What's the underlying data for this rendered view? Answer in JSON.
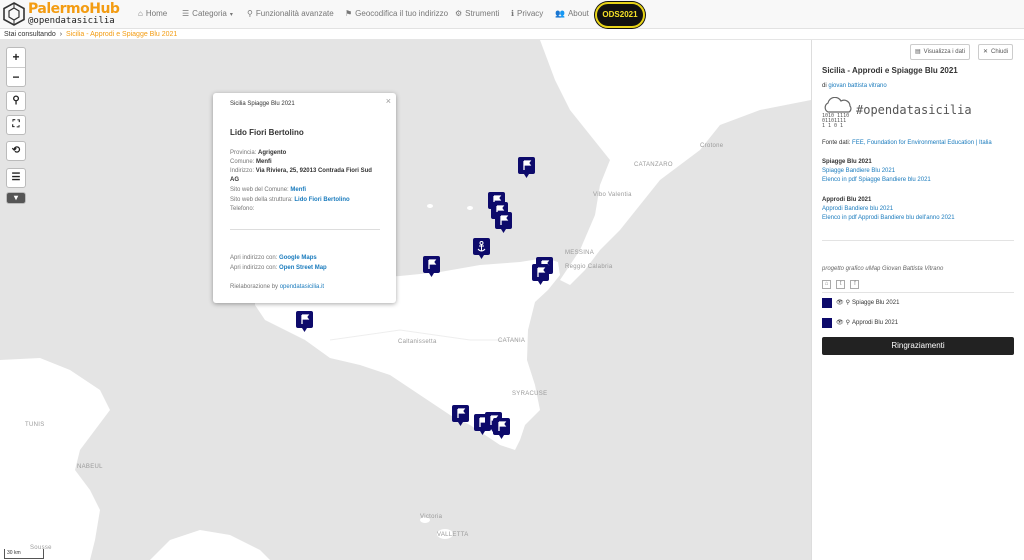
{
  "brand": {
    "title": "PalermoHub",
    "subtitle": "@opendatasicilia"
  },
  "nav": {
    "home": "Home",
    "categoria": "Categoria",
    "funzionalita": "Funzionalità avanzate",
    "geocodifica": "Geocodifica il tuo indirizzo",
    "strumenti": "Strumenti",
    "privacy": "Privacy",
    "about": "About",
    "ods": "ODS2021"
  },
  "breadcrumb": {
    "prefix": "Stai consultando",
    "current": "Sicilia - Approdi e Spiagge Blu 2021"
  },
  "map": {
    "labels": {
      "catanzaro": "CATANZARO",
      "crotone": "Crotone",
      "vibo": "Vibo Valentia",
      "messina": "MESSINA",
      "reggio": "Reggio Calabria",
      "caltanissetta": "Caltanissetta",
      "catania": "CATANIA",
      "syracuse": "SYRACUSE",
      "tunis": "TUNIS",
      "nabeul": "NABEUL",
      "sousse": "Sousse",
      "valletta": "VALLETTA",
      "victoria": "Victoria"
    },
    "scale": "30 km",
    "zoom_in": "+",
    "zoom_out": "−"
  },
  "popup": {
    "layer": "Sicilia Spiagge Blu 2021",
    "name": "Lido Fiori Bertolino",
    "provincia_label": "Provincia:",
    "provincia": "Agrigento",
    "comune_label": "Comune:",
    "comune": "Menfi",
    "indirizzo_label": "Indirizzo:",
    "indirizzo": "Via Riviera, 25, 92013 Contrada Fiori Sud",
    "indirizzo2": "AG",
    "sito_comune_label": "Sito web del Comune:",
    "sito_comune": "Menfi",
    "sito_struttura_label": "Sito web della struttura:",
    "sito_struttura": "Lido Fiori Bertolino",
    "telefono_label": "Telefono:",
    "apri1_label": "Apri indirizzo con:",
    "apri1": "Google Maps",
    "apri2_label": "Apri indirizzo con:",
    "apri2": "Open Street Map",
    "rielab_label": "Rielaborazione by",
    "rielab": "opendatasicilia.it",
    "close": "×"
  },
  "sidebar": {
    "btn_view": "Visualizza i dati",
    "btn_close": "Chiudi",
    "title": "Sicilia - Approdi e Spiagge Blu 2021",
    "author_prefix": "di",
    "author": "giovan battista vitrano",
    "logo_text": "#opendatasicilia",
    "logo_bin1": "1010 1110",
    "logo_bin2": "01101111",
    "logo_bin3": "  1   1 0 1",
    "fonte_label": "Fonte dati:",
    "fonte": "FEE, Foundation for Environmental Education | Italia",
    "spiagge_head": "Spiagge Blu 2021",
    "spiagge_link1": "Spiagge Bandiere Blu 2021",
    "spiagge_link2": "Elenco in pdf Spiagge Bandiere blu 2021",
    "approdi_head": "Approdi Blu 2021",
    "approdi_link1": "Approdi Bandiere blu 2021",
    "approdi_link2": "Elenco in pdf Approdi Bandiere blu dell'anno 2021",
    "progetto": "progetto grafico uMap Giovan Battista Vitrano",
    "legend1": "Spiagge Blu 2021",
    "legend2": "Approdi Blu 2021",
    "grazie": "Ringraziamenti"
  },
  "colors": {
    "marker": "#0d0a6b",
    "accent": "#f39c12",
    "link": "#1a7bbd"
  }
}
